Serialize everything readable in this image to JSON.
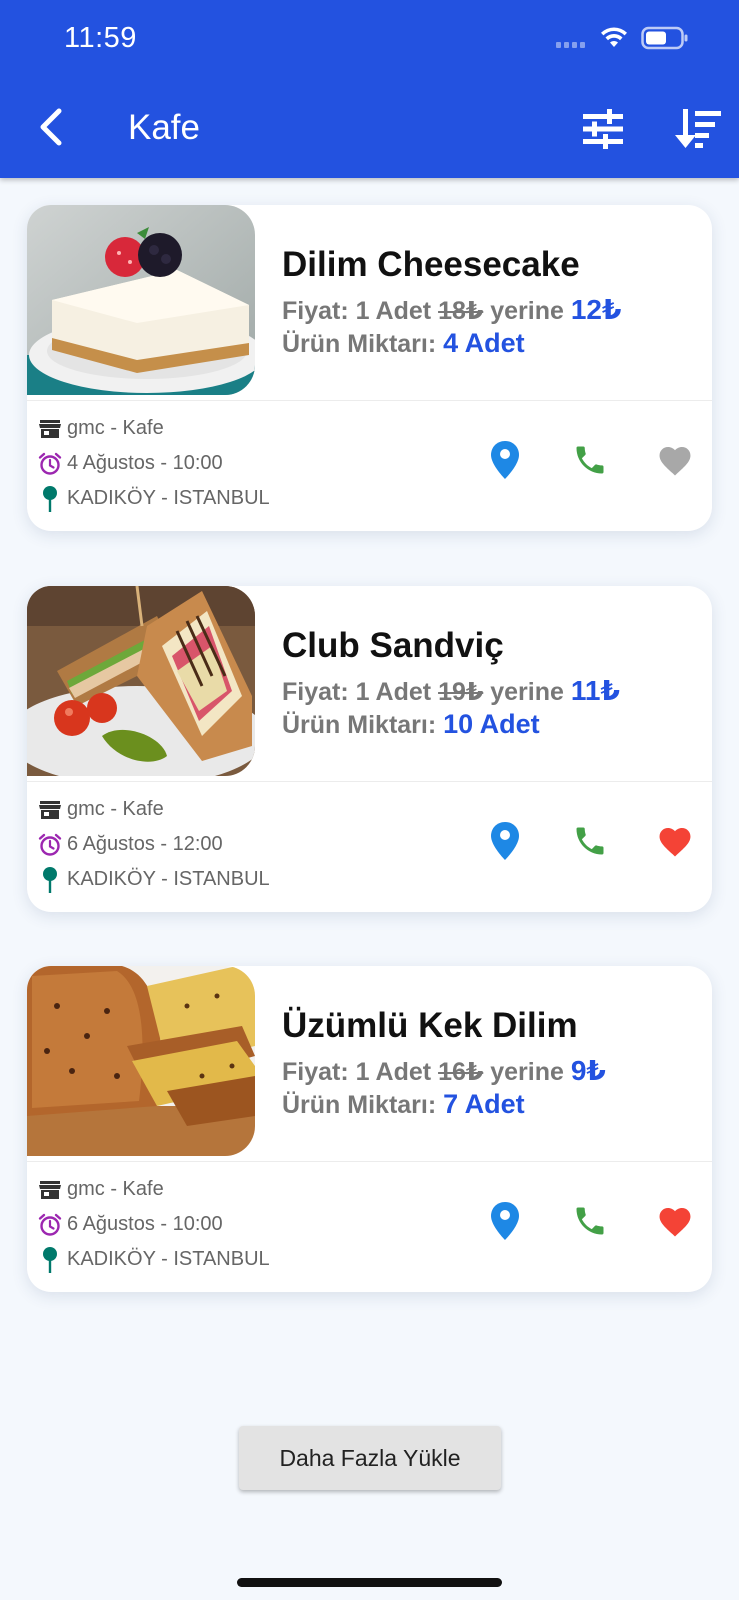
{
  "status_bar": {
    "time": "11:59"
  },
  "header": {
    "title": "Kafe"
  },
  "products": [
    {
      "name": "Dilim Cheesecake",
      "price_prefix": "Fiyat: 1 Adet",
      "old_price": "18₺",
      "price_mid": "yerine",
      "new_price": "12₺",
      "qty_label": "Ürün Miktarı:",
      "qty_value": "4 Adet",
      "store": "gmc  - Kafe",
      "datetime": "4 Ağustos - 10:00",
      "location": "KADIKÖY - ISTANBUL",
      "favorite": false
    },
    {
      "name": "Club Sandviç",
      "price_prefix": "Fiyat: 1 Adet",
      "old_price": "19₺",
      "price_mid": "yerine",
      "new_price": "11₺",
      "qty_label": "Ürün Miktarı:",
      "qty_value": "10 Adet",
      "store": "gmc  - Kafe",
      "datetime": "6 Ağustos - 12:00",
      "location": "KADIKÖY - ISTANBUL",
      "favorite": true
    },
    {
      "name": "Üzümlü Kek Dilim",
      "price_prefix": "Fiyat: 1 Adet",
      "old_price": "16₺",
      "price_mid": "yerine",
      "new_price": "9₺",
      "qty_label": "Ürün Miktarı:",
      "qty_value": "7 Adet",
      "store": "gmc  - Kafe",
      "datetime": "6 Ağustos - 10:00",
      "location": "KADIKÖY - ISTANBUL",
      "favorite": true
    }
  ],
  "load_more_label": "Daha Fazla Yükle",
  "icons": {
    "back": "chevron-left-icon",
    "filter": "tune-icon",
    "sort": "sort-icon",
    "store": "store-icon",
    "alarm": "alarm-clock-icon",
    "pin": "map-pin-icon",
    "location": "location-marker-icon",
    "phone": "phone-icon",
    "favorite": "heart-icon"
  },
  "colors": {
    "primary": "#2352e0",
    "location_blue": "#1e88e5",
    "phone_green": "#43a047",
    "fav_active": "#f44336",
    "fav_inactive": "#a8a8a8",
    "alarm_purple": "#9c27b0",
    "pin_teal": "#00796b"
  }
}
